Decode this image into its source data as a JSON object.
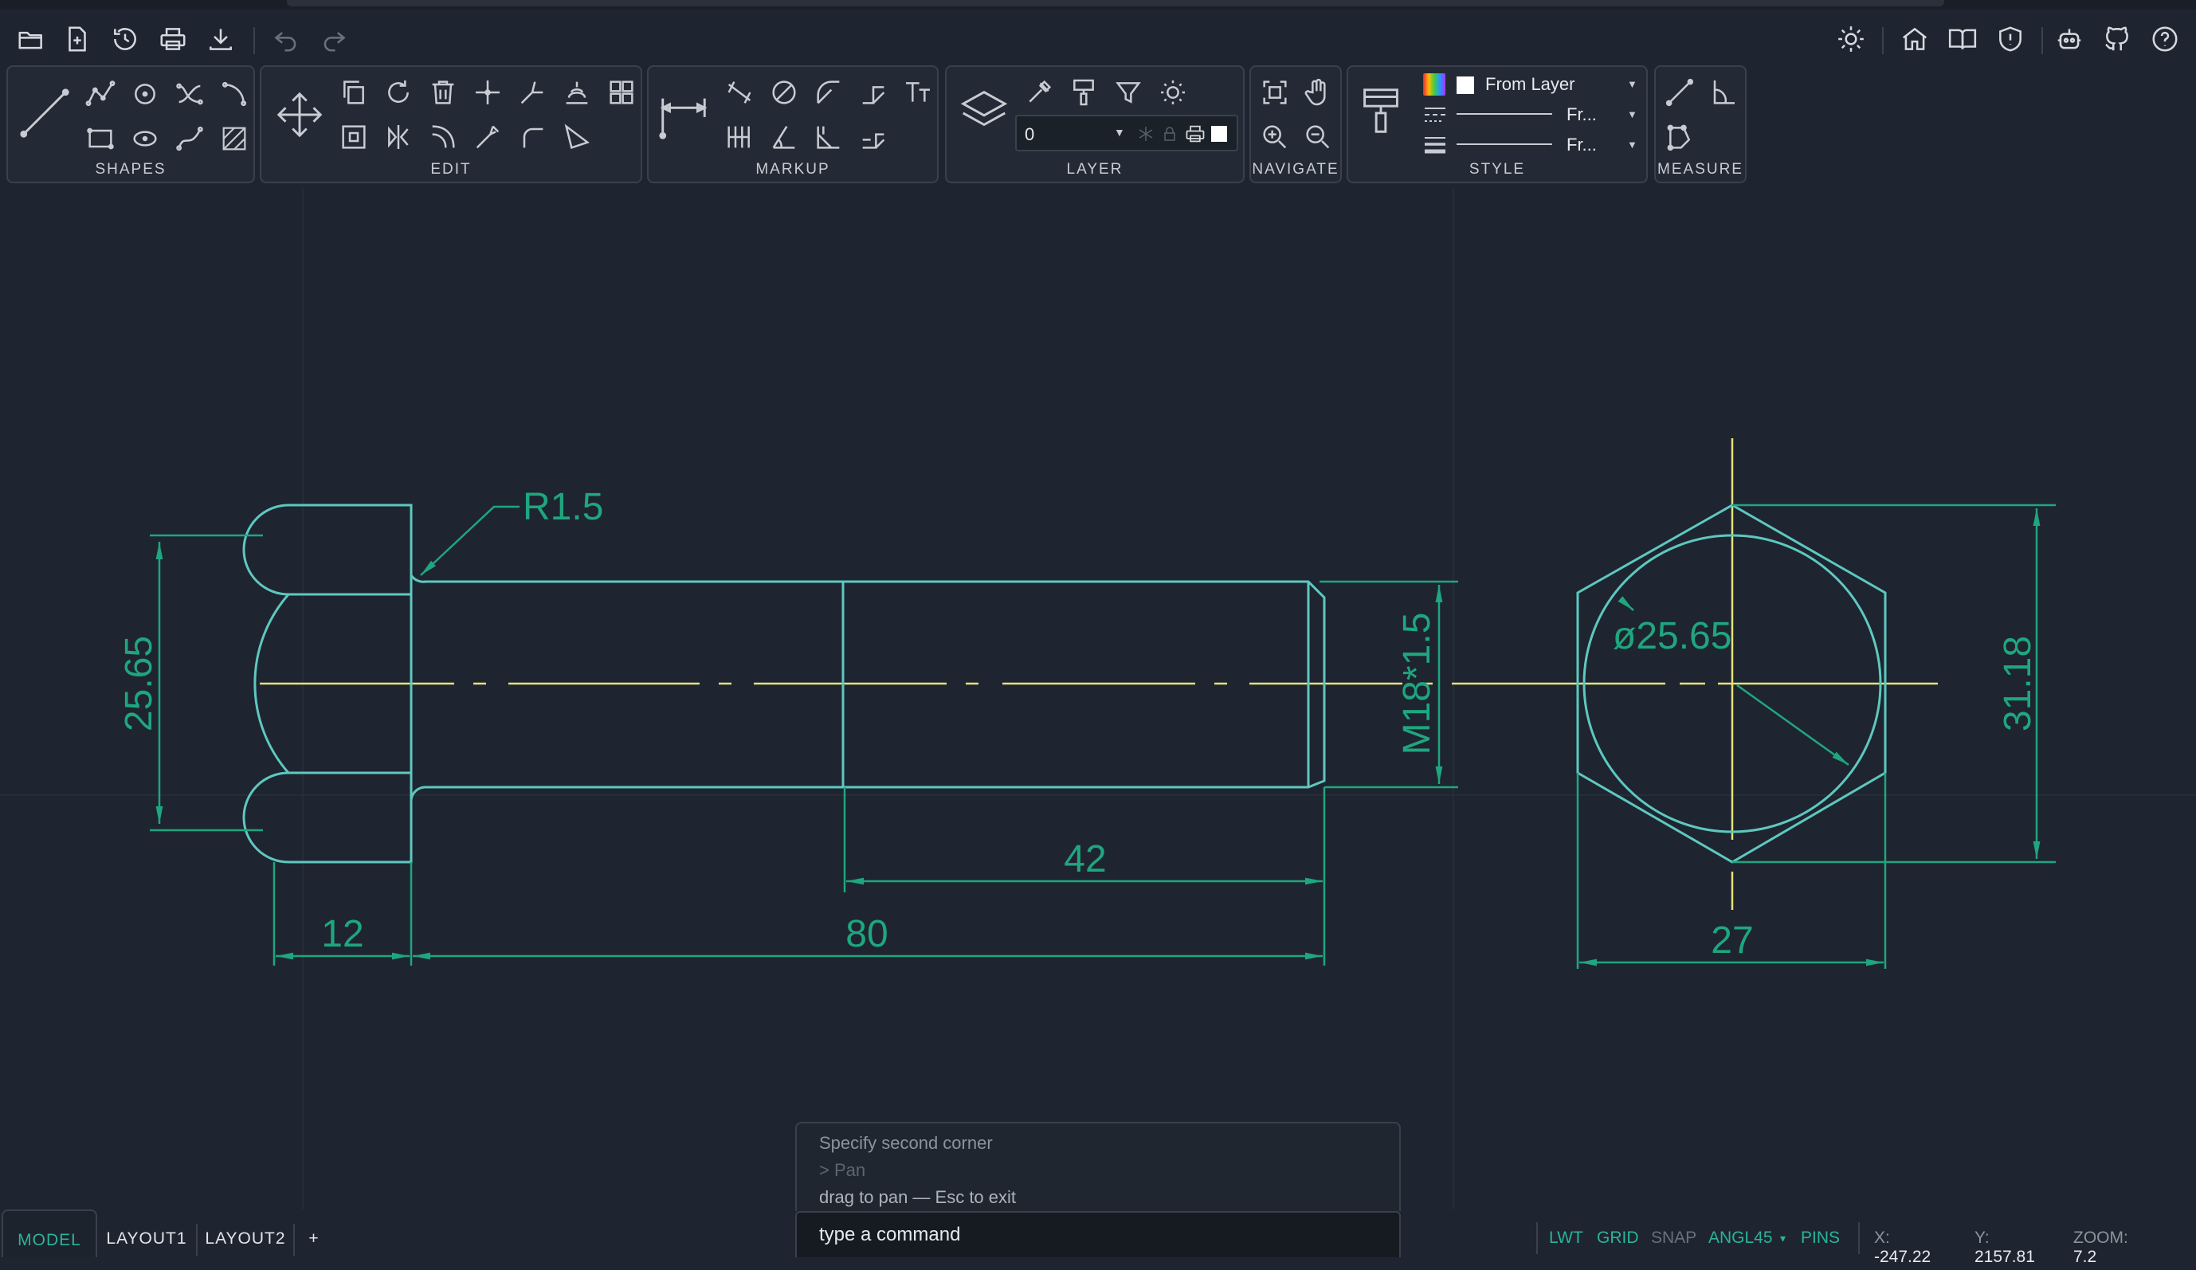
{
  "menubar": {
    "left_icons": [
      "open-icon",
      "new-file-icon",
      "history-icon",
      "print-icon",
      "download-icon",
      "undo-icon",
      "redo-icon"
    ],
    "right_icons": [
      "theme-sun-icon",
      "home-icon",
      "docs-book-icon",
      "shield-icon",
      "bot-icon",
      "github-icon",
      "help-icon"
    ]
  },
  "ribbon": {
    "shapes": {
      "label": "SHAPES"
    },
    "edit": {
      "label": "EDIT"
    },
    "markup": {
      "label": "MARKUP"
    },
    "layer": {
      "label": "LAYER",
      "current_layer": "0"
    },
    "navigate": {
      "label": "NAVIGATE"
    },
    "style": {
      "label": "STYLE",
      "color_value": "From Layer",
      "linetype_value": "Fr...",
      "lineweight_value": "Fr..."
    },
    "measure": {
      "label": "MEASURE"
    }
  },
  "drawing": {
    "dims": {
      "radius": "R1.5",
      "head_height": "25.65",
      "head_width": "12",
      "shank_length": "80",
      "thread_length": "42",
      "thread_spec": "M18*1.5",
      "circle_dia": "ø25.65",
      "hex_height": "31.18",
      "hex_width": "27"
    },
    "colors": {
      "geometry": "#5ec8c0",
      "dimension": "#1fa67f",
      "centerline": "#e6e27a",
      "background": "#1e2530",
      "grid": "#27303b"
    }
  },
  "command": {
    "log": [
      "Specify second corner",
      "> Pan",
      "drag to pan — Esc to exit"
    ],
    "input_placeholder": "type a command"
  },
  "tabs": {
    "model": "MODEL",
    "layout1": "LAYOUT1",
    "layout2": "LAYOUT2",
    "add": "+"
  },
  "status": {
    "lwt": "LWT",
    "grid": "GRID",
    "snap": "SNAP",
    "angle": "ANGL45",
    "angle_arrow": "▾",
    "pins": "PINS",
    "x_label": "X:",
    "x_value": "-247.22",
    "y_label": "Y:",
    "y_value": "2157.81",
    "zoom_label": "ZOOM:",
    "zoom_value": "7.2"
  }
}
